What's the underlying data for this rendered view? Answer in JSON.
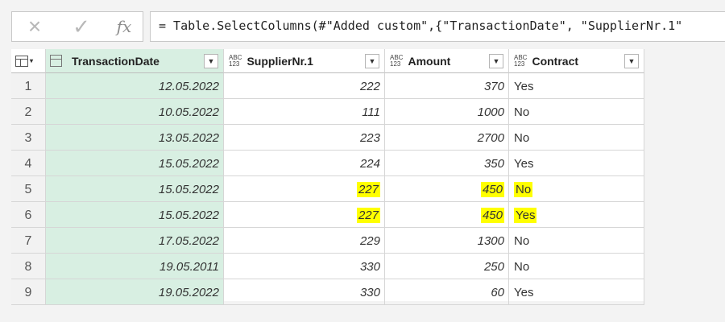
{
  "formula_bar": {
    "cancel_icon": "×",
    "commit_icon": "✓",
    "fx_label": "fx",
    "formula": "= Table.SelectColumns(#\"Added custom\",{\"TransactionDate\", \"SupplierNr.1\""
  },
  "columns": [
    {
      "label": "TransactionDate",
      "type_icon": "date-icon"
    },
    {
      "label": "SupplierNr.1",
      "type_icon": "ABC\n123"
    },
    {
      "label": "Amount",
      "type_icon": "ABC\n123"
    },
    {
      "label": "Contract",
      "type_icon": "ABC\n123"
    }
  ],
  "highlight_color": "#ffff00",
  "rows": [
    {
      "n": "1",
      "date": "12.05.2022",
      "supplier": "222",
      "amount": "370",
      "contract": "Yes"
    },
    {
      "n": "2",
      "date": "10.05.2022",
      "supplier": "111",
      "amount": "1000",
      "contract": "No"
    },
    {
      "n": "3",
      "date": "13.05.2022",
      "supplier": "223",
      "amount": "2700",
      "contract": "No"
    },
    {
      "n": "4",
      "date": "15.05.2022",
      "supplier": "224",
      "amount": "350",
      "contract": "Yes"
    },
    {
      "n": "5",
      "date": "15.05.2022",
      "supplier": "227",
      "amount": "450",
      "contract": "No"
    },
    {
      "n": "6",
      "date": "15.05.2022",
      "supplier": "227",
      "amount": "450",
      "contract": "Yes"
    },
    {
      "n": "7",
      "date": "17.05.2022",
      "supplier": "229",
      "amount": "1300",
      "contract": "No"
    },
    {
      "n": "8",
      "date": "19.05.2011",
      "supplier": "330",
      "amount": "250",
      "contract": "No"
    },
    {
      "n": "9",
      "date": "19.05.2022",
      "supplier": "330",
      "amount": "60",
      "contract": "Yes"
    }
  ]
}
